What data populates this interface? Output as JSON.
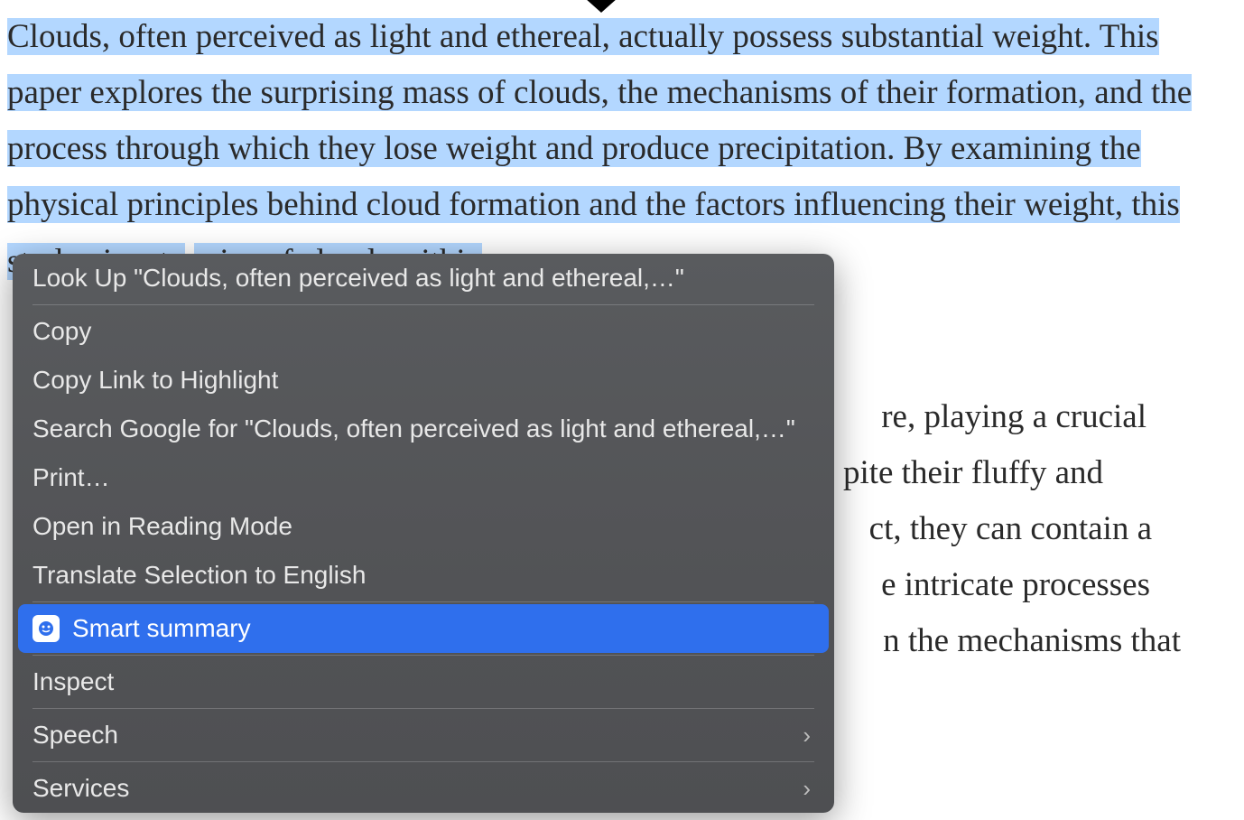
{
  "document": {
    "selected_text": "Clouds, often perceived as light and ethereal, actually possess substantial weight. This paper explores the surprising mass of clouds, the mechanisms of their formation, and the process through which they lose weight and produce precipitation. By examining the physical principles behind cloud formation and the factors influencing their weight, this study aims to",
    "continuation_visible_1": "mics of clouds within",
    "body_line_1": "re, playing a crucial",
    "body_line_2": "pite their fluffy and",
    "body_line_3": "ct, they can contain a",
    "body_line_4": "e intricate processes",
    "body_line_5": "n the mechanisms that"
  },
  "context_menu": {
    "items": {
      "look_up": "Look Up \"Clouds, often perceived as light and ethereal,…\"",
      "copy": "Copy",
      "copy_link": "Copy Link to Highlight",
      "search_google": "Search Google for \"Clouds, often perceived as light and ethereal,…\"",
      "print": "Print…",
      "reading_mode": "Open in Reading Mode",
      "translate": "Translate Selection to English",
      "smart_summary": "Smart summary",
      "inspect": "Inspect",
      "speech": "Speech",
      "services": "Services"
    },
    "highlighted_index": 7
  },
  "colors": {
    "selection": "#b3d7ff",
    "menu_bg": "#545558",
    "menu_highlight": "#2f6fed",
    "menu_text": "#e8e8e8"
  }
}
